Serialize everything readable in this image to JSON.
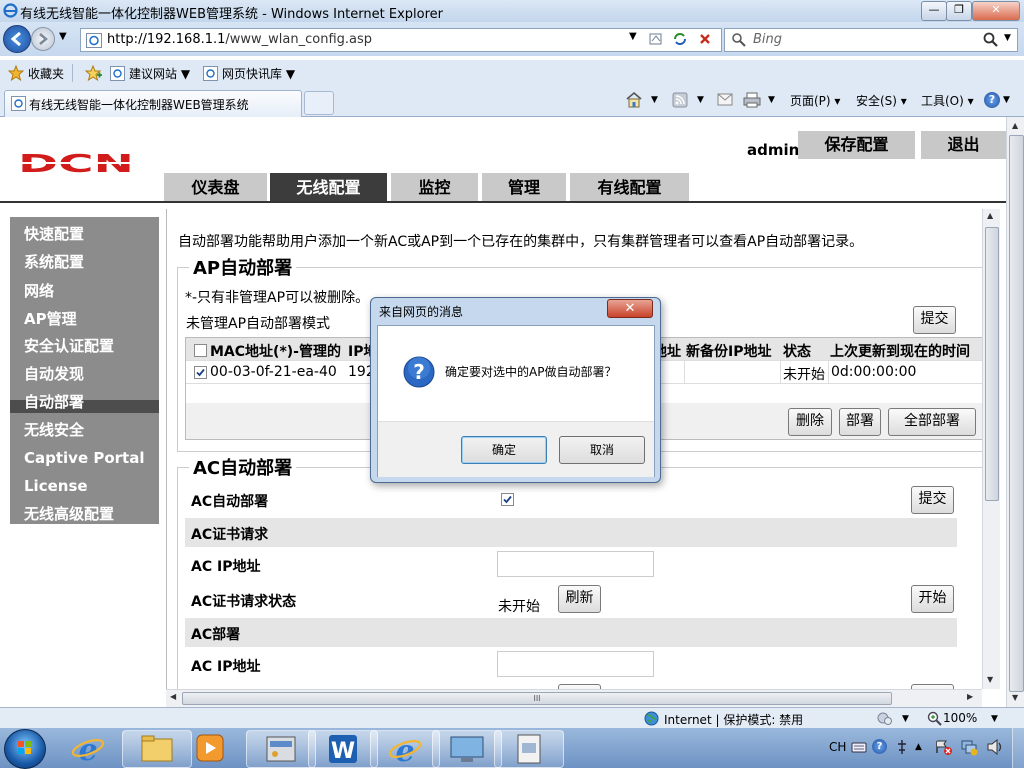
{
  "window": {
    "title": "有线无线智能一体化控制器WEB管理系统 - Windows Internet Explorer",
    "minimize": "—",
    "restore": "❐",
    "close": "✕"
  },
  "navbar": {
    "url_host": "http://192.168.1.1",
    "url_path": "/www_wlan_config.asp",
    "search_placeholder": "Bing"
  },
  "favorites": {
    "label": "收藏夹",
    "items": [
      "建议网站 ▼",
      "网页快讯库 ▼"
    ]
  },
  "tab": {
    "title": "有线无线智能一体化控制器WEB管理系统"
  },
  "commands": [
    "页面(P) ▾",
    "安全(S) ▾",
    "工具(O) ▾"
  ],
  "header": {
    "logo": "DCN",
    "user": "admin",
    "save_label": "保存配置",
    "logout_label": "退出",
    "tabs": [
      "仪表盘",
      "无线配置",
      "监控",
      "管理",
      "有线配置"
    ],
    "active_tab": "无线配置"
  },
  "sidebar": {
    "items": [
      "快速配置",
      "系统配置",
      "网络",
      "AP管理",
      "安全认证配置",
      "自动发现",
      "自动部署",
      "无线安全",
      "Captive Portal",
      "License",
      "无线高级配置"
    ],
    "active": "自动部署"
  },
  "content": {
    "intro": "自动部署功能帮助用户添加一个新AC或AP到一个已存在的集群中，只有集群管理者可以查看AP自动部署记录。",
    "ap_section": {
      "legend": "AP自动部署",
      "note": "*-只有非管理AP可以被删除。",
      "mode_label": "未管理AP自动部署模式",
      "submit_label": "提交",
      "columns": [
        "MAC地址(*)-管理的",
        "IP地",
        "地址",
        "新备份IP地址",
        "状态",
        "上次更新到现在的时间"
      ],
      "rows": [
        {
          "checked": true,
          "mac": "00-03-0f-21-ea-40",
          "ip": "192",
          "status": "未开始",
          "elapsed": "0d:00:00:00"
        }
      ],
      "delete_label": "删除",
      "deploy_label": "部署",
      "deploy_all_label": "全部部署"
    },
    "ac_section": {
      "legend": "AC自动部署",
      "auto_label": "AC自动部署",
      "auto_checked": true,
      "submit_label": "提交",
      "cert_header": "AC证书请求",
      "ac_ip_label": "AC IP地址",
      "cert_status_label": "AC证书请求状态",
      "cert_status_value": "未开始",
      "refresh_label": "刷新",
      "start_label": "开始",
      "deploy_header": "AC部署",
      "ac_ip_label2": "AC IP地址"
    },
    "hscroll_grip": "III"
  },
  "dialog": {
    "title": "来自网页的消息",
    "message": "确定要对选中的AP做自动部署？",
    "ok_label": "确定",
    "cancel_label": "取消",
    "close": "✕"
  },
  "statusbar": {
    "zone": "Internet | 保护模式: 禁用",
    "zoom": "100%"
  },
  "taskbar": {
    "tray_lang": "CH"
  },
  "colors": {
    "active_tab": "#3c3c3c",
    "sidebar_bg": "#4d4d4d",
    "sidebar_hl": "#8c8c8c",
    "logo_red": "#d21c1c"
  }
}
